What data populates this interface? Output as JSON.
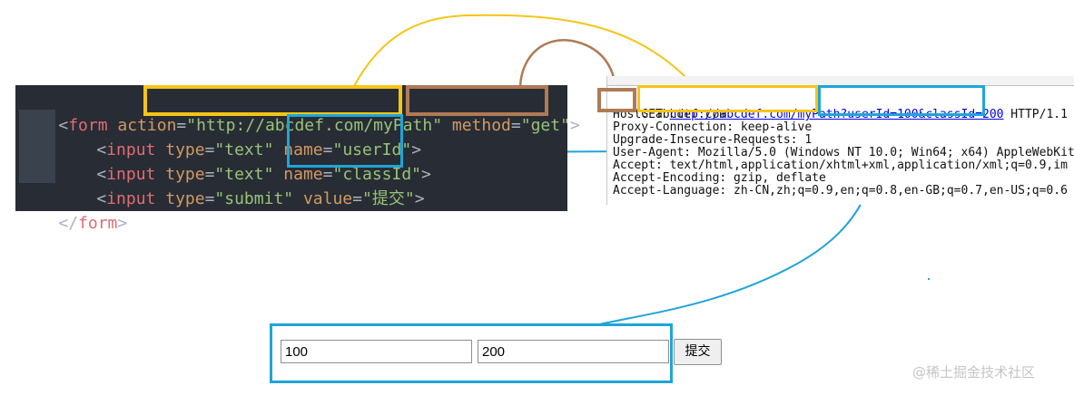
{
  "code": {
    "line1": {
      "open": "<",
      "tag": "form",
      "attr1": " action",
      "eq1": "=",
      "val1": "\"http://abcdef.com/myPath\"",
      "attr2": " method",
      "eq2": "=",
      "val2": "\"get\"",
      "close": ">"
    },
    "line2": {
      "open": "<",
      "tag": "input",
      "a1": " type",
      "eq1": "=",
      "v1": "\"text\"",
      "a2": " name",
      "eq2": "=",
      "v2": "\"userId\"",
      "close": ">"
    },
    "line3": {
      "open": "<",
      "tag": "input",
      "a1": " type",
      "eq1": "=",
      "v1": "\"text\"",
      "a2": " name",
      "eq2": "=",
      "v2": "\"classId\"",
      "close": ">"
    },
    "line4": {
      "open": "<",
      "tag": "input",
      "a1": " type",
      "eq1": "=",
      "v1": "\"submit\"",
      "a2": " value",
      "eq2": "=",
      "v2": "\"提交\"",
      "close": ">"
    },
    "line5": {
      "open": "</",
      "tag": "form",
      "close": ">"
    }
  },
  "http": {
    "method": "GET",
    "url_path": "http://abcdef.com/myPath",
    "url_query": "?userId=100&classId=200",
    "protocol": " HTTP/1.1",
    "headers": [
      "Host: abcdef.com",
      "Proxy-Connection: keep-alive",
      "Upgrade-Insecure-Requests: 1",
      "User-Agent: Mozilla/5.0 (Windows NT 10.0; Win64; x64) AppleWebKit",
      "Accept: text/html,application/xhtml+xml,application/xml;q=0.9,im",
      "Accept-Encoding: gzip, deflate",
      "Accept-Language: zh-CN,zh;q=0.9,en;q=0.8,en-GB;q=0.7,en-US;q=0.6"
    ]
  },
  "form": {
    "field1_value": "100",
    "field2_value": "200",
    "submit_label": "提交"
  },
  "watermark": "@稀土掘金技术社区",
  "colors": {
    "action_highlight": "#f5c518",
    "method_highlight": "#b07a55",
    "query_highlight": "#1ea5d8"
  }
}
